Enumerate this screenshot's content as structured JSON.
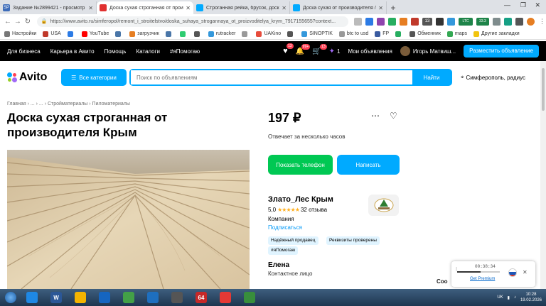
{
  "browser": {
    "tabs": [
      {
        "label": "Задание №2899421 - просмотр з",
        "favicon_text": "SP",
        "favicon_color": "#3d6cb9",
        "active": false
      },
      {
        "label": "Доска сухая строганная от прои",
        "favicon_text": "",
        "favicon_color": "#e0302f",
        "active": true
      },
      {
        "label": "Строганная рейка, брусок, доски",
        "favicon_text": "",
        "favicon_color": "#00aaff",
        "active": false
      },
      {
        "label": "Доска сухая от производителя / С",
        "favicon_text": "",
        "favicon_color": "#00aaff",
        "active": false
      }
    ],
    "url": "https://www.avito.ru/simferopol/remont_i_stroitelstvo/doska_suhaya_strogannaya_ot_proizvoditelya_krym_7917155655?context...",
    "extension_badges": [
      "13",
      "LTC",
      "33.3"
    ],
    "bookmarks": [
      {
        "label": "Настройки",
        "color": "#777"
      },
      {
        "label": "USA",
        "color": "#c0392b"
      },
      {
        "label": "",
        "color": "#2c7be5"
      },
      {
        "label": "YouTube",
        "color": "#ff0000"
      },
      {
        "label": "",
        "color": "#4a76a8"
      },
      {
        "label": "загрузчик",
        "color": "#e67e22"
      },
      {
        "label": "",
        "color": "#4a76a8"
      },
      {
        "label": "",
        "color": "#2ecc71"
      },
      {
        "label": "",
        "color": "#555"
      },
      {
        "label": "rutracker",
        "color": "#3498db"
      },
      {
        "label": "",
        "color": "#999"
      },
      {
        "label": "UAKino",
        "color": "#e74c3c"
      },
      {
        "label": "",
        "color": "#555"
      },
      {
        "label": "SINOPTIK",
        "color": "#3498db"
      },
      {
        "label": "btc to usd",
        "color": "#999"
      },
      {
        "label": "FP",
        "color": "#3a5ba0"
      },
      {
        "label": "",
        "color": "#27ae60"
      },
      {
        "label": "Обменник",
        "color": "#555"
      },
      {
        "label": "maps",
        "color": "#34a853"
      },
      {
        "label": "Другие закладки",
        "color": "#f1c40f"
      }
    ]
  },
  "avito_nav": {
    "links": [
      "Для бизнеса",
      "Карьера в Авито",
      "Помощь",
      "Каталоги",
      "#яПомогаю"
    ],
    "favorites_badge": "13",
    "notifications_badge": "99+",
    "cart_badge": "13",
    "wallet_count": "1",
    "my_ads": "Мои объявления",
    "user_name": "Игорь Матвиш...",
    "post_button": "Разместить объявление"
  },
  "search": {
    "logo": "Avito",
    "categories_button": "Все категории",
    "placeholder": "Поиск по объявлениям",
    "find_button": "Найти",
    "location": "Симферополь, радиус"
  },
  "breadcrumbs": "Главная  ›  ...  ›  ...  ›  Стройматериалы  ›  Пиломатериалы",
  "listing": {
    "title": "Доска сухая строганная от производителя Крым",
    "price": "197 ₽",
    "reply_time": "Отвечает за несколько часов",
    "show_phone": "Показать телефон",
    "write": "Написать"
  },
  "seller": {
    "name": "Злато_Лес Крым",
    "rating": "5,0",
    "stars": "★★★★★",
    "reviews": "32 отзыва",
    "type": "Компания",
    "subscribe": "Подписаться",
    "tags": [
      "Надёжный продавец",
      "Реквизиты проверены",
      "#яПомогаю"
    ],
    "contact_name": "Елена",
    "contact_role": "Контактное лицо"
  },
  "popup": {
    "timer": "00:38:34",
    "link": "Get Premium",
    "partial_text": "Coo"
  },
  "taskbar": {
    "apps": [
      {
        "label": "",
        "color": "#1e88e5"
      },
      {
        "label": "W",
        "color": "#2b5797"
      },
      {
        "label": "",
        "color": "#f4b400"
      },
      {
        "label": "",
        "color": "#1565c0"
      },
      {
        "label": "",
        "color": "#43a047"
      },
      {
        "label": "",
        "color": "#1e6fbf"
      },
      {
        "label": "",
        "color": "#555"
      },
      {
        "label": "64",
        "color": "#c62828"
      },
      {
        "label": "",
        "color": "#e53935"
      },
      {
        "label": "",
        "color": "#388e3c"
      }
    ],
    "lang": "UK",
    "time": "10:28",
    "date": "19.02.2026"
  }
}
